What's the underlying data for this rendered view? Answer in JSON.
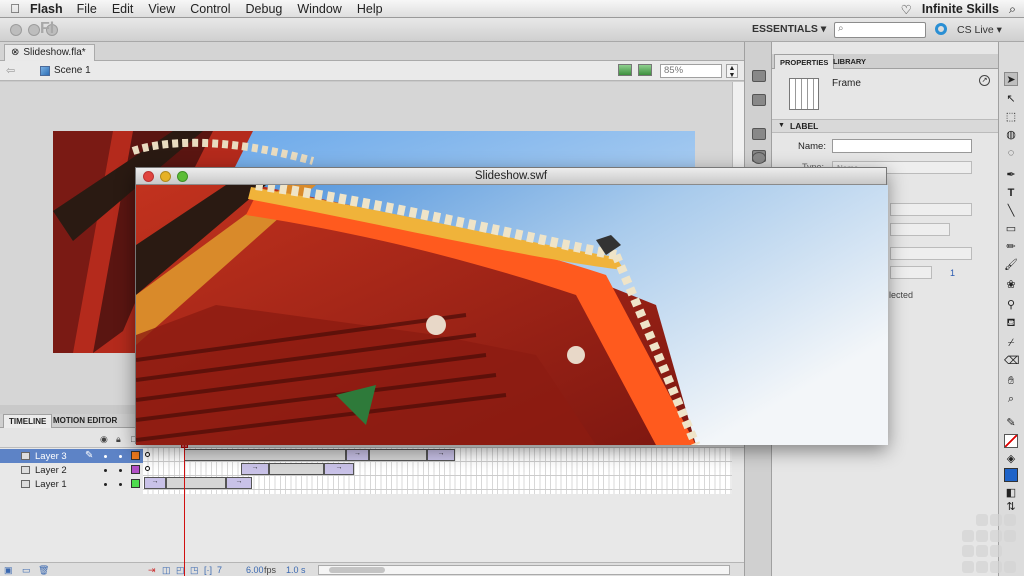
{
  "menubar": {
    "app_name": "Flash",
    "items": [
      "File",
      "Edit",
      "View",
      "Control",
      "Debug",
      "Window",
      "Help"
    ],
    "brand": "Infinite Skills"
  },
  "apptoolbar": {
    "logo": "Fl",
    "workspace": "ESSENTIALS ▾",
    "search_placeholder": "",
    "cs_live": "CS Live ▾"
  },
  "document": {
    "tab": "Slideshow.fla*",
    "scene": "Scene 1",
    "zoom": "85%"
  },
  "timeline": {
    "tabs": [
      "TIMELINE",
      "MOTION EDITOR"
    ],
    "layers": [
      {
        "name": "Layer 3",
        "color": "#f07c1e",
        "selected": true
      },
      {
        "name": "Layer 2",
        "color": "#b24fc6",
        "selected": false
      },
      {
        "name": "Layer 1",
        "color": "#4fdc4f",
        "selected": false
      }
    ],
    "current_frame": "7",
    "fps": "6.00",
    "fps_unit": "fps",
    "time": "1.0 s"
  },
  "swf_window": {
    "title": "Slideshow.swf"
  },
  "properties": {
    "tabs": [
      "PROPERTIES",
      "LIBRARY"
    ],
    "object_type": "Frame",
    "section_label": "LABEL",
    "name_label": "Name:",
    "name_value": "",
    "type_label": "Type:",
    "type_value": "Name",
    "count_value": "1",
    "partial_text": "lected"
  }
}
